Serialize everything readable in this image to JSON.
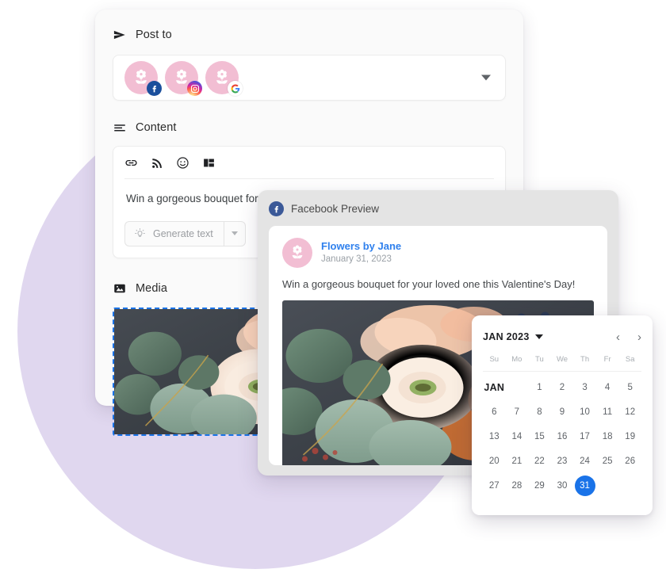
{
  "composer": {
    "post_to": {
      "label": "Post to",
      "icon": "send-icon"
    },
    "accounts": [
      {
        "name": "Flowers by Jane",
        "platform": "facebook",
        "badge_icon": "facebook-icon"
      },
      {
        "name": "Flowers by Jane",
        "platform": "instagram",
        "badge_icon": "instagram-icon"
      },
      {
        "name": "Flowers by Jane",
        "platform": "google",
        "badge_icon": "google-icon"
      }
    ],
    "content": {
      "label": "Content",
      "icon": "text-lines-icon",
      "toolbar": [
        "link-icon",
        "rss-icon",
        "emoji-icon",
        "layout-icon"
      ],
      "text": "Win a gorgeous bouquet for your loved one this Valentine's Day!",
      "generate_button": {
        "label": "Generate text",
        "icon": "lightbulb-icon"
      }
    },
    "media": {
      "label": "Media",
      "icon": "image-icon",
      "alt": "Floral bouquet with eucalyptus, white ranunculus and peach flowers"
    }
  },
  "facebook_preview": {
    "header": {
      "label": "Facebook Preview",
      "icon": "facebook-icon"
    },
    "page_name": "Flowers by Jane",
    "date": "January 31, 2023",
    "post_text": "Win a gorgeous bouquet for your loved one this Valentine's Day!",
    "photo_alt": "Floral bouquet with eucalyptus, white ranunculus, peach flowers and berries"
  },
  "calendar": {
    "title": "JAN 2023",
    "prev_label": "‹",
    "next_label": "›",
    "weekdays": [
      "Su",
      "Mo",
      "Tu",
      "We",
      "Th",
      "Fr",
      "Sa"
    ],
    "month_label": "JAN",
    "leading_blanks": 2,
    "days": [
      1,
      2,
      3,
      4,
      5,
      6,
      7,
      8,
      9,
      10,
      11,
      12,
      13,
      14,
      15,
      16,
      17,
      18,
      19,
      20,
      21,
      22,
      23,
      24,
      25,
      26,
      27,
      28,
      29,
      30,
      31
    ],
    "selected_day": 31
  },
  "colors": {
    "background_circle": "#e0d7ef",
    "accent_blue": "#1a73e8",
    "brand_pink": "#f2bed3",
    "facebook_blue": "#3b5998",
    "link_blue": "#2f80ed"
  }
}
